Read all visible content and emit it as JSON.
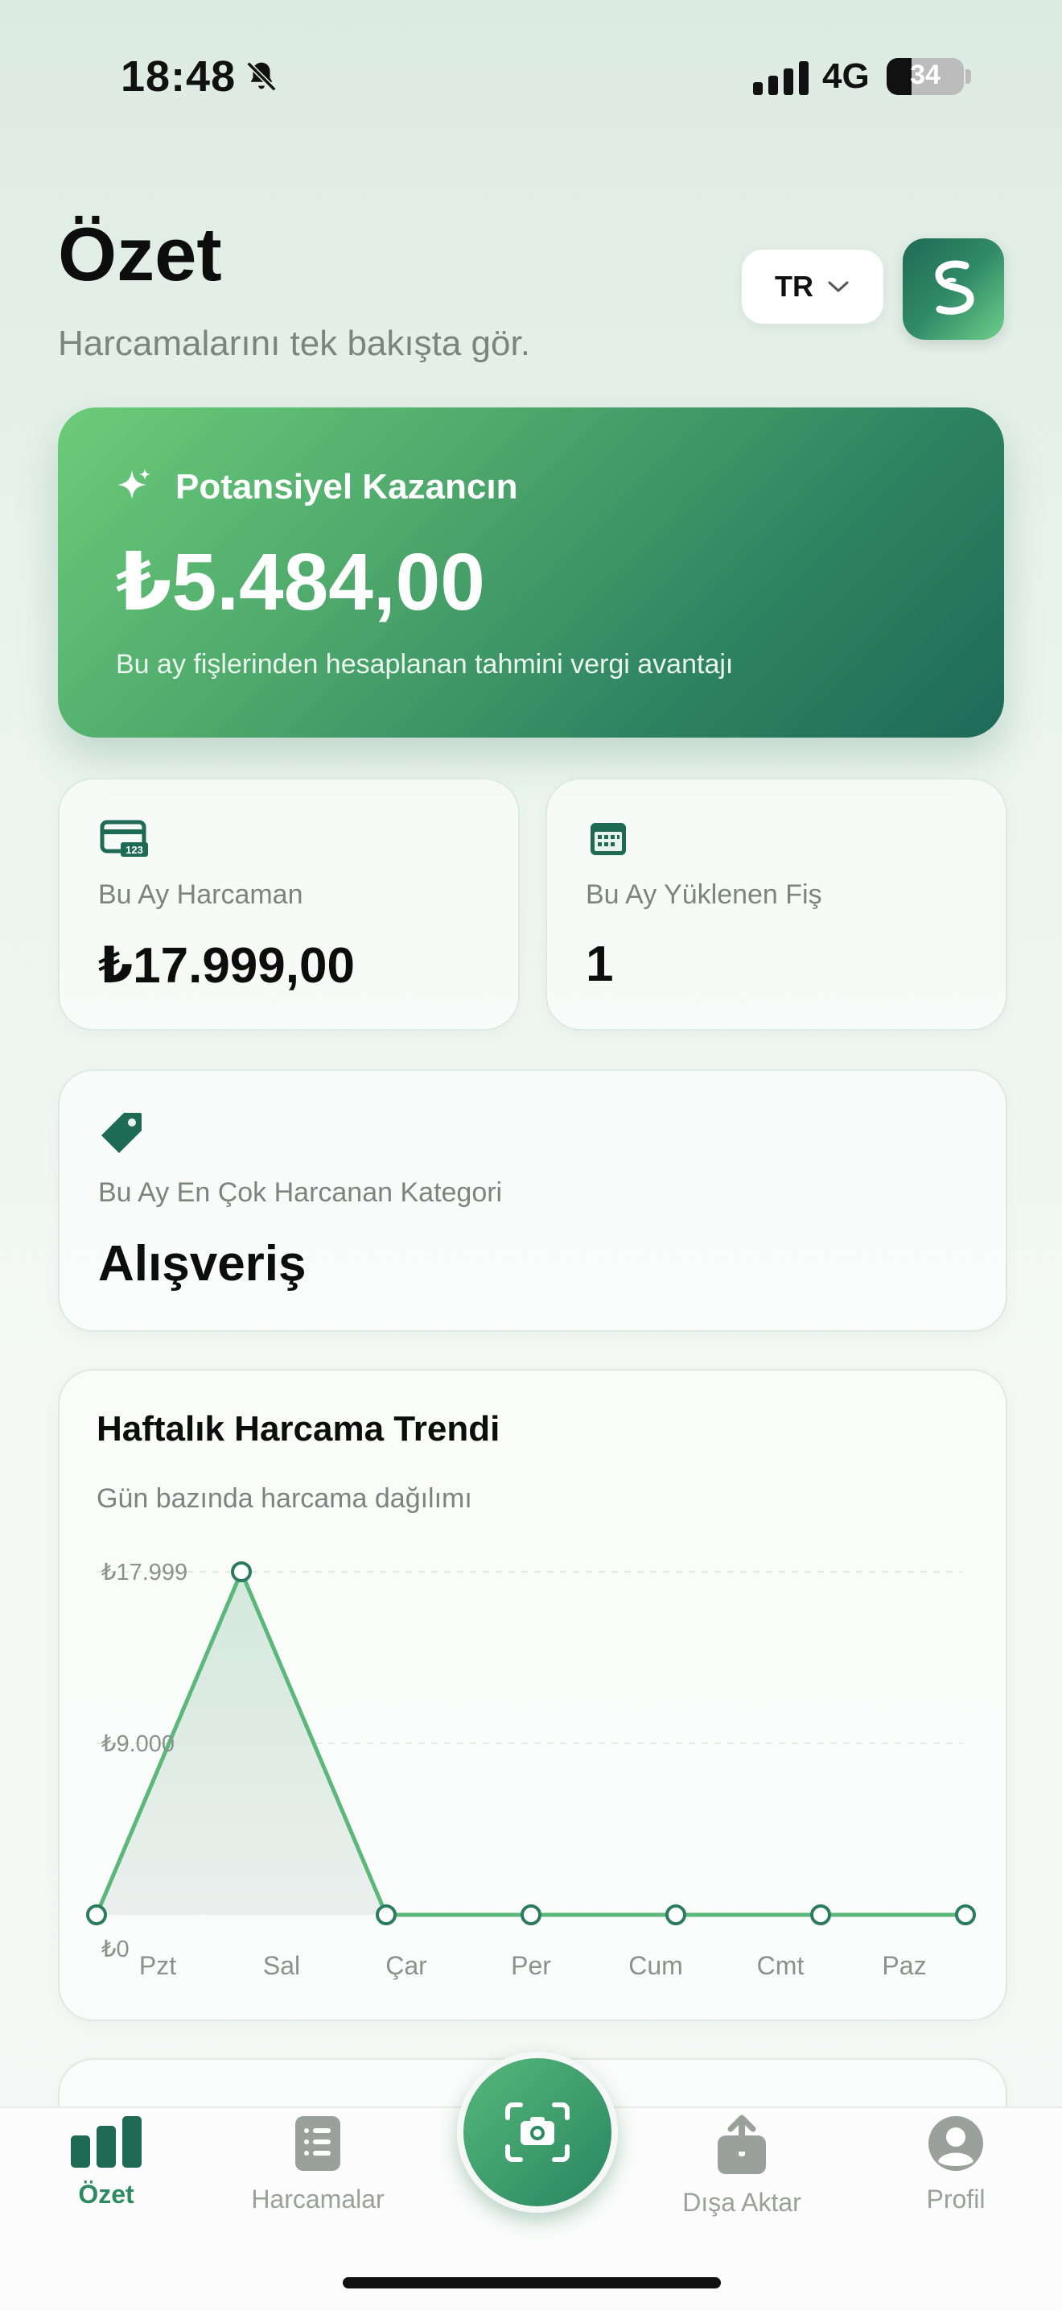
{
  "status_bar": {
    "time": "18:48",
    "network": "4G",
    "battery_percent": "34"
  },
  "header": {
    "title": "Özet",
    "subtitle": "Harcamalarını tek bakışta gör.",
    "language": "TR"
  },
  "hero": {
    "label": "Potansiyel Kazancın",
    "amount": "₺5.484,00",
    "note": "Bu ay fişlerinden hesaplanan tahmini vergi avantajı"
  },
  "stats": {
    "monthly_spend_label": "Bu Ay Harcaman",
    "monthly_spend_value": "₺17.999,00",
    "receipts_label": "Bu Ay Yüklenen Fiş",
    "receipts_value": "1",
    "top_category_label": "Bu Ay En Çok Harcanan Kategori",
    "top_category_value": "Alışveriş"
  },
  "chart_data": {
    "type": "area",
    "title": "Haftalık Harcama Trendi",
    "subtitle": "Gün bazında harcama dağılımı",
    "categories": [
      "Pzt",
      "Sal",
      "Çar",
      "Per",
      "Cum",
      "Cmt",
      "Paz"
    ],
    "values": [
      0,
      17999,
      0,
      0,
      0,
      0,
      0
    ],
    "y_ticks": [
      "₺0",
      "₺9.000",
      "₺17.999"
    ],
    "ylim": [
      0,
      17999
    ],
    "grid": true,
    "line_color": "#5cb87a"
  },
  "tabbar": {
    "items": [
      {
        "label": "Özet",
        "icon": "bar-chart-icon",
        "active": true
      },
      {
        "label": "Harcamalar",
        "icon": "list-icon",
        "active": false
      },
      {
        "label": "Dışa Aktar",
        "icon": "share-icon",
        "active": false
      },
      {
        "label": "Profil",
        "icon": "profile-icon",
        "active": false
      }
    ],
    "scan_icon": "camera-scan-icon"
  },
  "colors": {
    "accent": "#2e8a63",
    "hero_start": "#6ccc7a",
    "hero_end": "#1e6b58"
  }
}
